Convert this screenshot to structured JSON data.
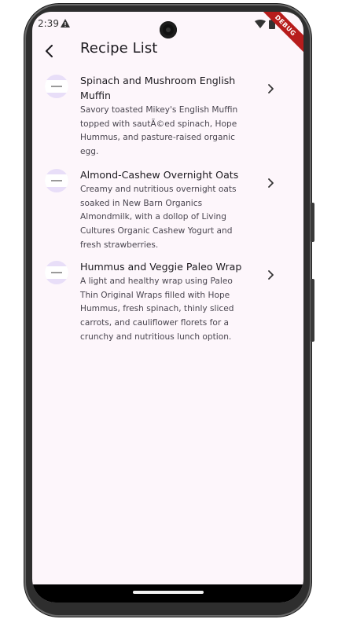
{
  "status_bar": {
    "time": "2:39",
    "debug_label": "DEBUG"
  },
  "app_bar": {
    "title": "Recipe List"
  },
  "recipes": [
    {
      "title_line1": "Spinach and Mushroom English",
      "title_line2": "Muffin",
      "desc_lines": [
        "Savory toasted Mikey's English Muffin",
        "topped with sautÃ©ed spinach, Hope",
        "Hummus, and pasture-raised organic",
        "egg."
      ]
    },
    {
      "title_line1": "Almond-Cashew Overnight Oats",
      "title_line2": "",
      "desc_lines": [
        "Creamy and nutritious overnight oats",
        "soaked in New Barn Organics",
        "Almondmilk, with a dollop of Living",
        "Cultures Organic Cashew Yogurt and",
        "fresh strawberries."
      ]
    },
    {
      "title_line1": "Hummus and Veggie Paleo Wrap",
      "title_line2": "",
      "desc_lines": [
        "A light and healthy wrap using Paleo",
        "Thin Original Wraps filled with Hope",
        "Hummus, fresh spinach, thinly sliced",
        "carrots, and cauliflower florets for a",
        "crunchy and nutritious lunch option."
      ]
    }
  ],
  "icons": {
    "back": "arrow-back-icon",
    "chevron": "chevron-right-icon",
    "warning": "warning-icon",
    "wifi": "wifi-icon",
    "battery": "battery-icon"
  },
  "colors": {
    "background": "#fdf6fb",
    "avatar": "#e8def8",
    "title_text": "#1d1b20",
    "desc_text": "#49454f",
    "debug_banner": "#b71c1c"
  }
}
